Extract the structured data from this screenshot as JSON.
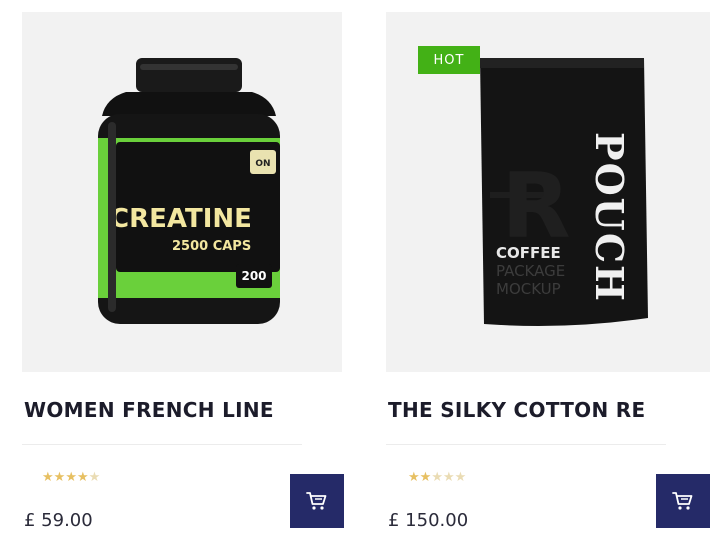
{
  "products": [
    {
      "name": "WOMEN FRENCH LINE",
      "price": "£ 59.00",
      "rating": 4.5,
      "rating_stars": [
        "★",
        "★",
        "★",
        "★",
        "★"
      ],
      "image": {
        "label_main": "CREATINE",
        "label_sub": "2500 CAPS",
        "label_count": "200",
        "label_badge": "ON"
      }
    },
    {
      "name": "THE SILKY COTTON RE",
      "price": "£ 150.00",
      "rating": 2,
      "badge": "HOT",
      "image": {
        "pouch_text": "POUCH",
        "coffee": "COFFEE",
        "package": "PACKAGE",
        "mockup": "MOCKUP",
        "letter": "R"
      }
    }
  ],
  "colors": {
    "accent": "#252a68",
    "hot_badge": "#43b116",
    "star": "#e7c062",
    "image_bg": "#f2f2f2"
  },
  "icons": {
    "cart": "shopping-cart-icon"
  }
}
